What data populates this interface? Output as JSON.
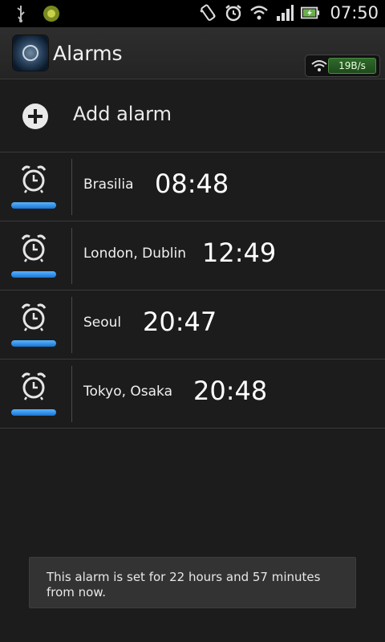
{
  "status_bar": {
    "time": "07:50",
    "icons": [
      "usb-icon",
      "app-notification-icon",
      "vibrate-icon",
      "alarm-icon",
      "wifi-icon",
      "signal-icon",
      "battery-charging-icon"
    ]
  },
  "header": {
    "title": "Alarms",
    "network_speed": "19B/s"
  },
  "add_alarm": {
    "label": "Add alarm"
  },
  "alarms": [
    {
      "city": "Brasilia",
      "time": "08:48",
      "enabled": true
    },
    {
      "city": "London, Dublin",
      "time": "12:49",
      "enabled": true
    },
    {
      "city": "Seoul",
      "time": "20:47",
      "enabled": true
    },
    {
      "city": "Tokyo, Osaka",
      "time": "20:48",
      "enabled": true
    }
  ],
  "toast": {
    "message": "This alarm is set for 22 hours and 57 minutes from now."
  },
  "colors": {
    "accent": "#1a73d1",
    "background": "#1c1c1c",
    "network_green": "#2f6a2a"
  }
}
